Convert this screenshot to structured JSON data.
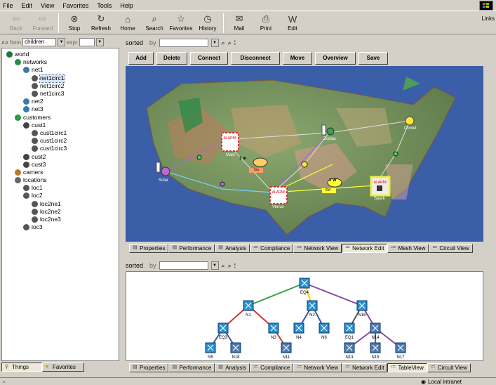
{
  "menu": [
    "File",
    "Edit",
    "View",
    "Favorites",
    "Tools",
    "Help"
  ],
  "toolbar": [
    {
      "label": "Back",
      "disabled": true,
      "icon": "back-arrow-icon",
      "glyph": "⇦"
    },
    {
      "label": "Forward",
      "disabled": true,
      "icon": "forward-arrow-icon",
      "glyph": "⇨"
    },
    {
      "label": "Stop",
      "disabled": false,
      "icon": "stop-icon",
      "glyph": "⊗"
    },
    {
      "label": "Refresh",
      "disabled": false,
      "icon": "refresh-icon",
      "glyph": "↻"
    },
    {
      "label": "Home",
      "disabled": false,
      "icon": "home-icon",
      "glyph": "⌂"
    },
    {
      "label": "Search",
      "disabled": false,
      "icon": "search-icon",
      "glyph": "⌕"
    },
    {
      "label": "Favorites",
      "disabled": false,
      "icon": "favorites-icon",
      "glyph": "☆"
    },
    {
      "label": "History",
      "disabled": false,
      "icon": "history-icon",
      "glyph": "◷"
    },
    {
      "label": "Mail",
      "disabled": false,
      "icon": "mail-icon",
      "glyph": "✉"
    },
    {
      "label": "Print",
      "disabled": false,
      "icon": "print-icon",
      "glyph": "⎙"
    },
    {
      "label": "Edit",
      "disabled": false,
      "icon": "edit-icon",
      "glyph": "W"
    }
  ],
  "links_label": "Links",
  "left_panel": {
    "from_label": "from",
    "from_value": "children",
    "expr_label": "expr",
    "tree": [
      {
        "label": "world",
        "indent": 0,
        "color": "#1a7a3a"
      },
      {
        "label": "networks",
        "indent": 1,
        "color": "#2a8a4a"
      },
      {
        "label": "net1",
        "indent": 2,
        "color": "#3a7aa8"
      },
      {
        "label": "net1circ1",
        "indent": 3,
        "color": "#555",
        "selected": true
      },
      {
        "label": "net1circ2",
        "indent": 3,
        "color": "#555"
      },
      {
        "label": "net1circ3",
        "indent": 3,
        "color": "#555"
      },
      {
        "label": "net2",
        "indent": 2,
        "color": "#3a7aa8"
      },
      {
        "label": "net3",
        "indent": 2,
        "color": "#3a7aa8"
      },
      {
        "label": "customers",
        "indent": 1,
        "color": "#2a9a3a"
      },
      {
        "label": "cust1",
        "indent": 2,
        "color": "#444"
      },
      {
        "label": "cust1circ1",
        "indent": 3,
        "color": "#555"
      },
      {
        "label": "cust1circ2",
        "indent": 3,
        "color": "#555"
      },
      {
        "label": "cust1circ3",
        "indent": 3,
        "color": "#555"
      },
      {
        "label": "cust2",
        "indent": 2,
        "color": "#444"
      },
      {
        "label": "cust3",
        "indent": 2,
        "color": "#444"
      },
      {
        "label": "carriers",
        "indent": 1,
        "color": "#b87a2a"
      },
      {
        "label": "locations",
        "indent": 1,
        "color": "#666"
      },
      {
        "label": "loc1",
        "indent": 2,
        "color": "#555"
      },
      {
        "label": "loc2",
        "indent": 2,
        "color": "#555"
      },
      {
        "label": "loc2ne1",
        "indent": 3,
        "color": "#555"
      },
      {
        "label": "loc2ne2",
        "indent": 3,
        "color": "#555"
      },
      {
        "label": "loc2ne3",
        "indent": 3,
        "color": "#555"
      },
      {
        "label": "loc3",
        "indent": 2,
        "color": "#555"
      }
    ],
    "tabs": [
      "Things",
      "Favorites"
    ]
  },
  "top_view": {
    "sorted_label": "sorted",
    "by_label": "by",
    "buttons": [
      "Add",
      "Delete",
      "Connect",
      "Disconnect",
      "Move",
      "Overview",
      "Save"
    ],
    "map_nodes": [
      "Solar",
      "Mars",
      "Venus",
      "Zodiac",
      "Comet",
      "Spark"
    ],
    "badges": [
      "1 m",
      "5m",
      "1 W",
      "5M"
    ],
    "alarm_label": "ALARM!",
    "tabs": [
      "Properties",
      "Performance",
      "Analysis",
      "Compliance",
      "Network View",
      "Network Edit",
      "Mesh View",
      "Circuit View"
    ],
    "active_tab": "Network Edit"
  },
  "bottom_view": {
    "sorted_label": "sorted",
    "by_label": "by",
    "nodes": [
      "EQ4",
      "N1",
      "N2",
      "N16",
      "EQ3",
      "N3",
      "N4",
      "N6",
      "EQ1",
      "N14",
      "N5",
      "N18",
      "N11",
      "N13",
      "N15",
      "N17"
    ],
    "tabs": [
      "Properties",
      "Performance",
      "Analysis",
      "Compliance",
      "Network View",
      "Network Edit",
      "TableView",
      "Circuit View"
    ],
    "active_tab": "TableView"
  },
  "status": {
    "zone": "Local intranet"
  }
}
